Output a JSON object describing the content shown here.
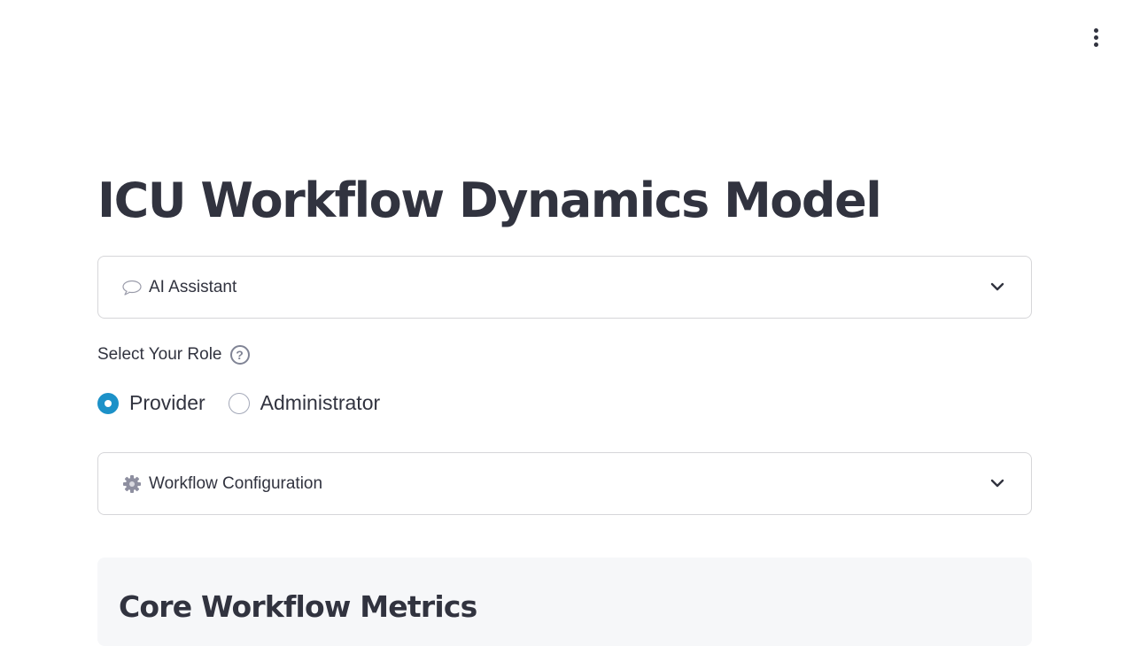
{
  "header": {
    "menu_icon": "vertical-ellipsis-icon"
  },
  "page": {
    "title": "ICU Workflow Dynamics Model"
  },
  "ai_assistant": {
    "label": "AI Assistant",
    "icon": "speech-bubble-icon",
    "expanded": false
  },
  "role_selector": {
    "label": "Select Your Role",
    "help_icon": "question-circle-icon",
    "options": [
      {
        "label": "Provider",
        "selected": true
      },
      {
        "label": "Administrator",
        "selected": false
      }
    ],
    "accent_color": "#1c91c8"
  },
  "workflow_config": {
    "label": "Workflow Configuration",
    "icon": "gear-icon",
    "expanded": false
  },
  "metrics": {
    "title": "Core Workflow Metrics"
  }
}
